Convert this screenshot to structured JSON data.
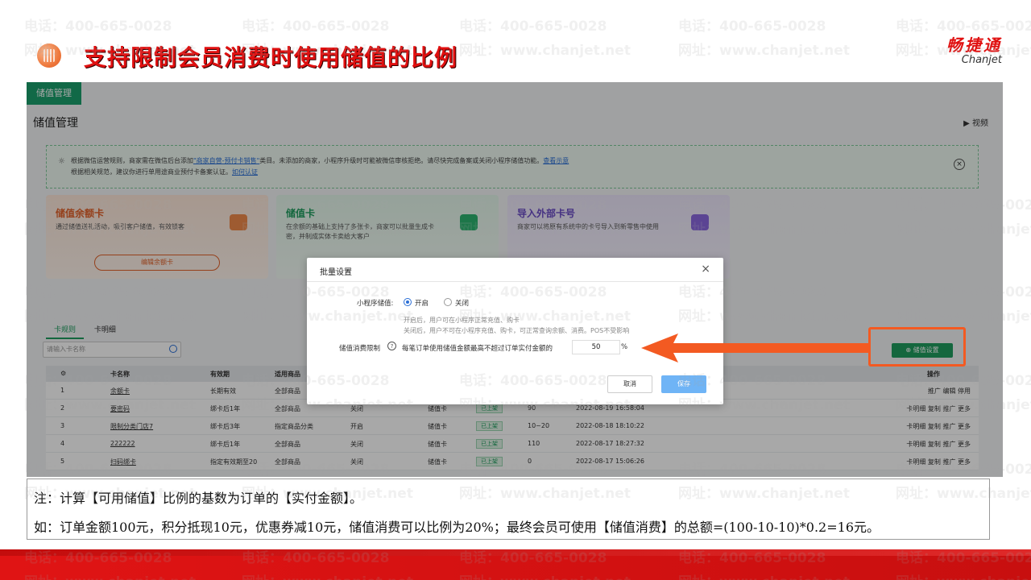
{
  "slide": {
    "title": "支持限制会员消费时使用储值的比例",
    "brand_cn": "畅捷通",
    "brand_en": "Chanjet"
  },
  "watermark": {
    "phone": "电话：400-665-0028",
    "site": "网址：www.chanjet.net"
  },
  "app": {
    "top_tab": "储值管理",
    "page_title": "储值管理",
    "video_link": "视频",
    "notice": {
      "line1_a": "根据微信运营规则，商家需在微信后台添加",
      "line1_link": "\"商家自营-预付卡销售\"",
      "line1_b": "类目。未添加的商家，小程序升级时可能被微信审核拒绝。请尽快完成备案或关闭小程序储值功能。",
      "line1_link2": "查看示意",
      "line2_a": "根据相关规范，建议你进行单用途商业预付卡备案认证。",
      "line2_link": "如何认证"
    },
    "cards": [
      {
        "title": "储值余额卡",
        "desc": "通过储值送礼活动，吸引客户储值，有效锁客",
        "button": "编辑余额卡"
      },
      {
        "title": "储值卡",
        "desc": "在余额的基础上支持了多张卡，商家可以批量生成卡密，并制成实体卡卖给大客户",
        "button": ""
      },
      {
        "title": "导入外部卡号",
        "desc": "商家可以将原有系统中的卡号导入到新零售中使用",
        "button": ""
      }
    ],
    "subtabs": [
      "卡规则",
      "卡明细"
    ],
    "search_placeholder": "请输入卡名称",
    "batch_button": "储值设置",
    "table": {
      "headers": [
        "",
        "卡名称",
        "有效期",
        "适用商品",
        "",
        "",
        "",
        "",
        "",
        "操作"
      ],
      "rows": [
        {
          "no": "1",
          "name": "余额卡",
          "validity": "长期有效",
          "goods": "全部商品",
          "status": "",
          "type": "",
          "tag": "",
          "amount": "",
          "time": "",
          "ops": "推广 编辑 停用"
        },
        {
          "no": "2",
          "name": "要密码",
          "validity": "绑卡后1年",
          "goods": "全部商品",
          "status": "关闭",
          "type": "储值卡",
          "tag": "已上架",
          "amount": "90",
          "time": "2022-08-19 16:58:04",
          "ops": "卡明细 复制 推广 更多"
        },
        {
          "no": "3",
          "name": "限制分类门店7",
          "validity": "绑卡后3年",
          "goods": "指定商品分类",
          "status": "开启",
          "type": "储值卡",
          "tag": "已上架",
          "amount": "10~20",
          "time": "2022-08-18 18:10:22",
          "ops": "卡明细 复制 推广 更多"
        },
        {
          "no": "4",
          "name": "222222",
          "validity": "绑卡后1年",
          "goods": "全部商品",
          "status": "关闭",
          "type": "储值卡",
          "tag": "已上架",
          "amount": "110",
          "time": "2022-08-17 18:27:32",
          "ops": "卡明细 复制 推广 更多"
        },
        {
          "no": "5",
          "name": "扫码绑卡",
          "validity": "指定有效期至20",
          "goods": "全部商品",
          "status": "关闭",
          "type": "储值卡",
          "tag": "已上架",
          "amount": "0",
          "time": "2022-08-17 15:06:26",
          "ops": "卡明细 复制 推广 更多"
        }
      ]
    },
    "dialog": {
      "title": "批量设置",
      "row1_label": "小程序储值:",
      "option_on": "开启",
      "option_off": "关闭",
      "hint1": "开启后，用户可在小程序正常充值、购卡",
      "hint2": "关闭后，用户不可在小程序充值、购卡，可正常查询余额、消费。POS不受影响",
      "row2_label": "储值消费限制",
      "help_icon_text": "?",
      "row2_text": "每笔订单使用储值金额最高不超过订单实付金额的",
      "percent_value": "50",
      "percent_sign": "%",
      "cancel": "取消",
      "save": "保存"
    }
  },
  "note": {
    "line1": "注：计算【可用储值】比例的基数为订单的【实付金额】。",
    "line2": "如：订单金额100元，积分抵现10元，优惠券减10元，储值消费可以比例为20%；最终会员可使用【储值消费】的总额=(100-10-10)*0.2=16元。"
  },
  "colors": {
    "accent_red": "#e01010",
    "annotation_orange": "#f35a22",
    "app_green": "#1f9d5f",
    "save_blue": "#6fb4f6"
  }
}
